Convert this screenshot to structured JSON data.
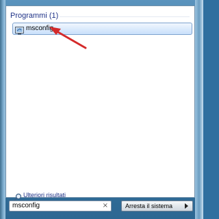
{
  "results": {
    "section_title": "Programmi (1)",
    "items": [
      {
        "label": "msconfig",
        "icon": "msconfig-icon"
      }
    ]
  },
  "more_results": {
    "label": "Ulteriori risultati",
    "icon": "search-icon"
  },
  "search": {
    "value": "msconfig",
    "clear_glyph": "×"
  },
  "shutdown": {
    "label": "Arresta il sistema"
  },
  "colors": {
    "accent": "#1e3287",
    "highlight": "#dcebfc",
    "arrow": "#d42a2a"
  }
}
